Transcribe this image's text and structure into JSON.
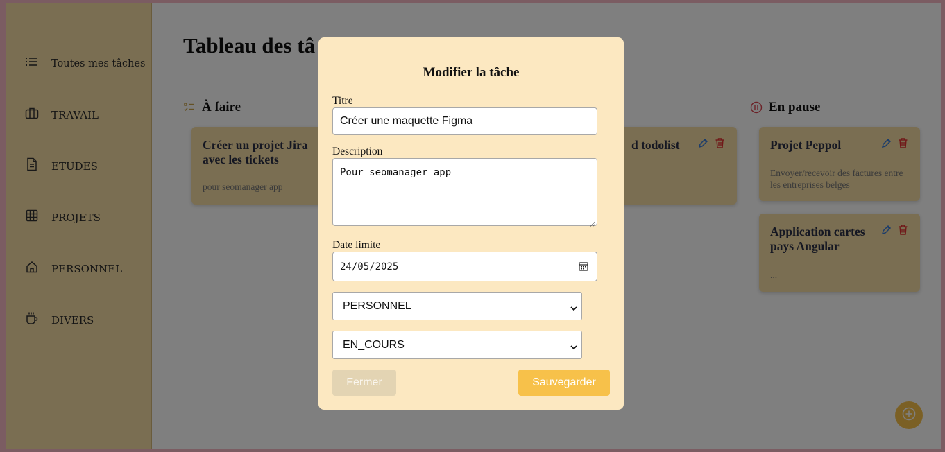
{
  "sidebar": {
    "items": [
      {
        "label": "Toutes mes tâches",
        "icon": "list-icon"
      },
      {
        "label": "TRAVAIL",
        "icon": "briefcase-icon"
      },
      {
        "label": "ETUDES",
        "icon": "document-icon"
      },
      {
        "label": "PROJETS",
        "icon": "grid-icon"
      },
      {
        "label": "PERSONNEL",
        "icon": "home-icon"
      },
      {
        "label": "DIVERS",
        "icon": "coffee-cup-icon"
      }
    ]
  },
  "main": {
    "title": "Tableau des tâ",
    "columns": [
      {
        "title": "À faire",
        "icon": "checklist-icon",
        "color": "#c9a24a"
      },
      {
        "title": "En pause",
        "icon": "pause-circle-icon",
        "color": "#d9434e"
      }
    ],
    "cards": {
      "todo_1": {
        "title": "Créer un projet Jira avec les tickets",
        "description": "pour seomanager app"
      },
      "inprogress_1": {
        "title_fragment": "d todolist"
      },
      "pause_1": {
        "title": "Projet Peppol",
        "description": "Envoyer/recevoir des factures entre les entreprises belges"
      },
      "pause_2": {
        "title": "Application cartes pays Angular",
        "description": "..."
      }
    }
  },
  "modal": {
    "title": "Modifier la tâche",
    "title_label": "Titre",
    "title_value": "Créer une maquette Figma",
    "description_label": "Description",
    "description_value": "Pour seomanager app",
    "date_label": "Date limite",
    "date_value": "24/05/2025",
    "category_value": "PERSONNEL",
    "status_value": "EN_COURS",
    "close_label": "Fermer",
    "save_label": "Sauvegarder"
  },
  "colors": {
    "accent": "#f7c14a",
    "sidebar_bg": "#f5dda5",
    "modal_bg": "#fce8c1",
    "edit_icon": "#3a7bd5",
    "delete_icon": "#e03131"
  }
}
